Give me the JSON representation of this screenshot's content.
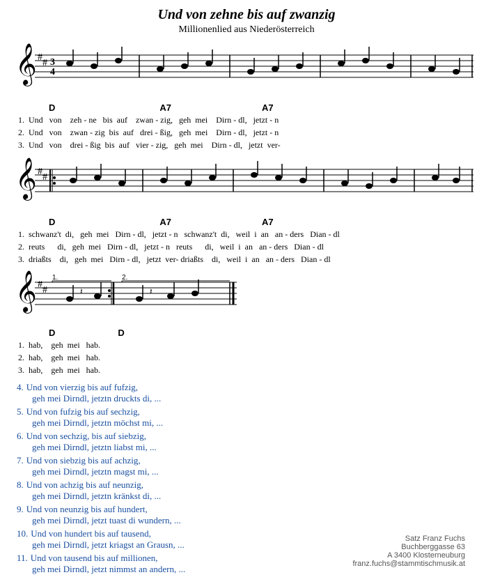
{
  "title": "Und von zehne bis auf zwanzig",
  "subtitle": "Millionenlied aus Niederösterreich",
  "staff1": {
    "description": "First staff with key signature and notes"
  },
  "chords_row1": [
    "D",
    "A7",
    "A7"
  ],
  "lyrics_verse1_row1": [
    {
      "num": "1.",
      "words": "Und   von    zeh - ne   bis   auf    zwan - zig,   geh   mei    Dirn - dl,   jetzt - n"
    },
    {
      "num": "2.",
      "words": "Und   von    zwan - zig  bis  auf    drei - ßig,   geh   mei    Dirn - dl,   jetzt - n"
    },
    {
      "num": "3.",
      "words": "Und   von    drei - ßig  bis  auf    vier - zig,   geh   mei    Dirn - dl,   jetzt  ver-"
    }
  ],
  "chords_row2": [
    "D",
    "A7",
    "A7"
  ],
  "lyrics_verse1_row2": [
    {
      "num": "1.",
      "words": "schwanz't  di,   geh   mei    Dirn - dl,   jetzt - n   schwanz't  di,   weil  i   an    an - ders   Dian - dl"
    },
    {
      "num": "2.",
      "words": "reuts      di,   geh   mei    Dirn - dl,   jetzt - n   reuts      di,   weil  i   an    an - ders   Dian - dl"
    },
    {
      "num": "3.",
      "words": "driaßts    di,   geh   mei    Dirn - dl,   jetzt  ver- driaßts    di,   weil  i   an    an - ders   Dian - dl"
    }
  ],
  "chords_ending": [
    "D",
    "D"
  ],
  "lyrics_ending": [
    {
      "num": "1.",
      "words": "hab,     geh   mei   hab."
    },
    {
      "num": "2.",
      "words": "hab,     geh   mei   hab."
    },
    {
      "num": "3.",
      "words": "hab,     geh   mei   hab."
    }
  ],
  "extra_verses": [
    {
      "num": "4.",
      "lines": [
        "Und von vierzig bis auf fufzig,",
        "geh mei Dirndl, jetztn druckts di, ..."
      ]
    },
    {
      "num": "5.",
      "lines": [
        "Und von fufzig bis auf sechzig,",
        "geh mei Dirndl, jetztn möchst mi, ..."
      ]
    },
    {
      "num": "6.",
      "lines": [
        "Und von sechzig, bis auf siebzig,",
        "geh mei Dirndl, jetztn liabst mi, ..."
      ]
    },
    {
      "num": "7.",
      "lines": [
        "Und von siebzig bis auf achzig,",
        "geh mei Dirndl, jetztn magst mi, ..."
      ]
    },
    {
      "num": "8.",
      "lines": [
        "Und von achzig bis auf neunzig,",
        "geh mei Dirndl, jetztn kränkst di, ..."
      ]
    },
    {
      "num": "9.",
      "lines": [
        "Und von neunzig bis auf hundert,",
        "geh mei Dirndl, jetzt tuast di wundern, ..."
      ]
    },
    {
      "num": "10.",
      "lines": [
        "Und von hundert bis auf tausend,",
        "geh mei Dirndl, jetzt kriagst an Grausn, ..."
      ]
    },
    {
      "num": "11.",
      "lines": [
        "Und von tausend bis auf millionen,",
        "geh mei Dirndl, jetzt nimmst an andern, ..."
      ]
    }
  ],
  "footer": {
    "line1": "Satz Franz Fuchs",
    "line2": "Buchberggasse 63",
    "line3": "A 3400 Klosterneuburg",
    "line4": "franz.fuchs@stammtischmusik.at"
  }
}
